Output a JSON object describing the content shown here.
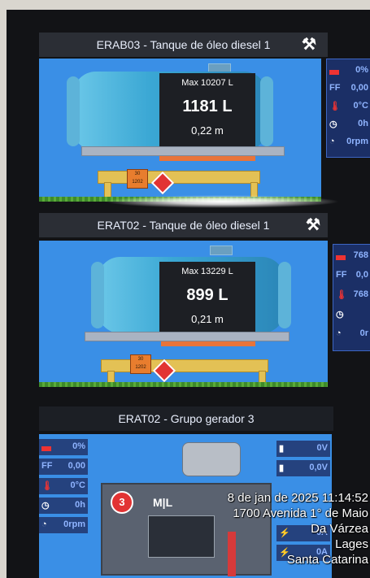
{
  "panels": [
    {
      "title": "ERAB03 - Tanque de óleo diesel 1",
      "max": "Max 10207 L",
      "level": "1181 L",
      "height": "0,22 m",
      "placard_top": "30",
      "placard_bottom": "1202",
      "side": [
        "0%",
        "0,00",
        "0°C",
        "0h",
        "0rpm"
      ],
      "ff": "FF"
    },
    {
      "title": "ERAT02 - Tanque de óleo diesel 1",
      "max": "Max 13229 L",
      "level": "899 L",
      "height": "0,21 m",
      "placard_top": "30",
      "placard_bottom": "1202",
      "side": [
        "768",
        "0,0",
        "768",
        "",
        "0r"
      ],
      "ff": "FF"
    }
  ],
  "generator": {
    "title": "ERAT02 - Grupo gerador 3",
    "left": [
      "0%",
      "0,00",
      "0°C",
      "0h",
      "0rpm"
    ],
    "ff": "FF",
    "right": [
      "0V",
      "0,0V",
      "0A",
      "0A"
    ],
    "number": "3",
    "brand": "M|L"
  },
  "overlay": {
    "datetime": "8 de jan de 2025 11:14:52",
    "address": "1700 Avenida 1° de Maio",
    "district": "Da Várzea",
    "city": "Lages",
    "state": "Santa Catarina"
  },
  "colors": {
    "panel_blue": "#3a8fe6",
    "side_navy": "#1b2f66",
    "header": "#2b2e35"
  }
}
